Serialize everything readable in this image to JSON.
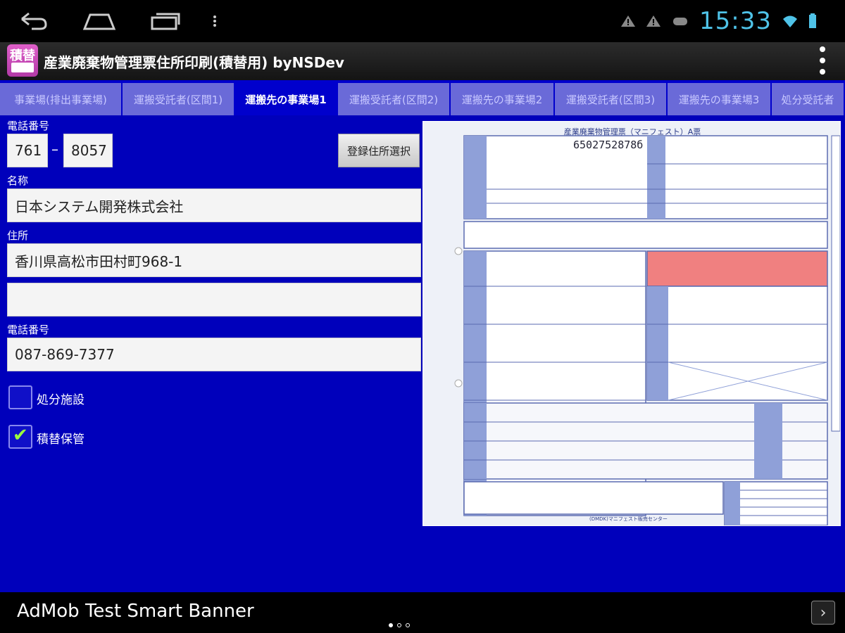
{
  "status_bar": {
    "time": "15:33",
    "icons": [
      "back-icon",
      "home-icon",
      "recents-icon",
      "menu-dots-icon",
      "warning-icon",
      "warning-icon",
      "gamepad-icon",
      "wifi-icon",
      "battery-icon"
    ]
  },
  "app_bar": {
    "icon_text": "積替",
    "title": "産業廃棄物管理票住所印刷(積替用) byNSDev"
  },
  "tabs": [
    {
      "label": "事業場(排出事業場)",
      "active": false
    },
    {
      "label": "運搬受託者(区間1)",
      "active": false
    },
    {
      "label": "運搬先の事業場1",
      "active": true
    },
    {
      "label": "運搬受託者(区間2)",
      "active": false
    },
    {
      "label": "運搬先の事業場2",
      "active": false
    },
    {
      "label": "運搬受託者(区間3)",
      "active": false
    },
    {
      "label": "運搬先の事業場3",
      "active": false
    },
    {
      "label": "処分受託者",
      "active": false
    }
  ],
  "form": {
    "postal_label": "電話番号",
    "postal_part1": "761",
    "postal_separator": "–",
    "postal_part2": "8057",
    "select_address_button": "登録住所選択",
    "name_label": "名称",
    "name_value": "日本システム開発株式会社",
    "address_label": "住所",
    "address_line1": "香川県高松市田村町968-1",
    "address_line2": "",
    "phone_label": "電話番号",
    "phone_value": "087-869-7377",
    "checkbox_disposal_label": "処分施設",
    "checkbox_disposal_checked": false,
    "checkbox_transfer_label": "積替保管",
    "checkbox_transfer_checked": true
  },
  "preview": {
    "title": "産業廃棄物管理票（マニフェスト）A票",
    "manifest_number": "6502752878б",
    "footer": "(DMDK)マニフェスト販売センター",
    "highlight_color": "#f08080"
  },
  "ad": {
    "text": "AdMob Test Smart Banner",
    "arrow": "›"
  },
  "colors": {
    "background_blue": "#0000bb",
    "tab_inactive": "#6a6ad8",
    "clock": "#4fc3e8",
    "check": "#9cff3c"
  }
}
